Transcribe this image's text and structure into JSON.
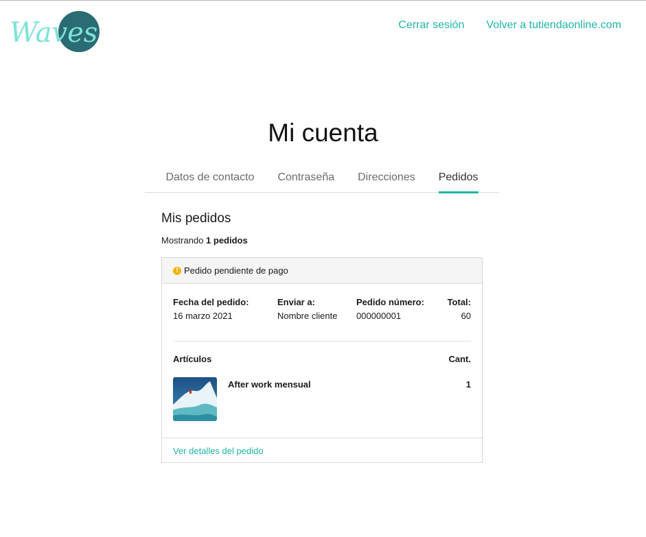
{
  "brand": {
    "logo_text": "Waves",
    "logo_colors": {
      "script": "#7ee3d6",
      "circle": "#2b6b73"
    }
  },
  "header": {
    "nav": [
      "Cerrar sesión",
      "Volver a tutiendaonline.com"
    ]
  },
  "page": {
    "title": "Mi cuenta"
  },
  "tabs": [
    {
      "label": "Datos de contacto",
      "active": false
    },
    {
      "label": "Contraseña",
      "active": false
    },
    {
      "label": "Direcciones",
      "active": false
    },
    {
      "label": "Pedidos",
      "active": true
    }
  ],
  "orders": {
    "title": "Mis pedidos",
    "showing_prefix": "Mostrando",
    "showing_count": "1 pedidos",
    "list": [
      {
        "status": "Pedido pendiente de pago",
        "status_icon": "warning-icon",
        "date_label": "Fecha del pedido:",
        "date": "16 marzo 2021",
        "ship_label": "Enviar a:",
        "ship_to": "Nombre cliente",
        "number_label": "Pedido número:",
        "number": "000000001",
        "total_label": "Total:",
        "total": "60",
        "items_label": "Artículos",
        "qty_label": "Cant.",
        "items": [
          {
            "name": "After work mensual",
            "qty": "1",
            "image": "wave-photo"
          }
        ],
        "details_link": "Ver detalles del pedido"
      }
    ]
  },
  "colors": {
    "accent": "#1fb5a6",
    "warning": "#f4b400"
  }
}
